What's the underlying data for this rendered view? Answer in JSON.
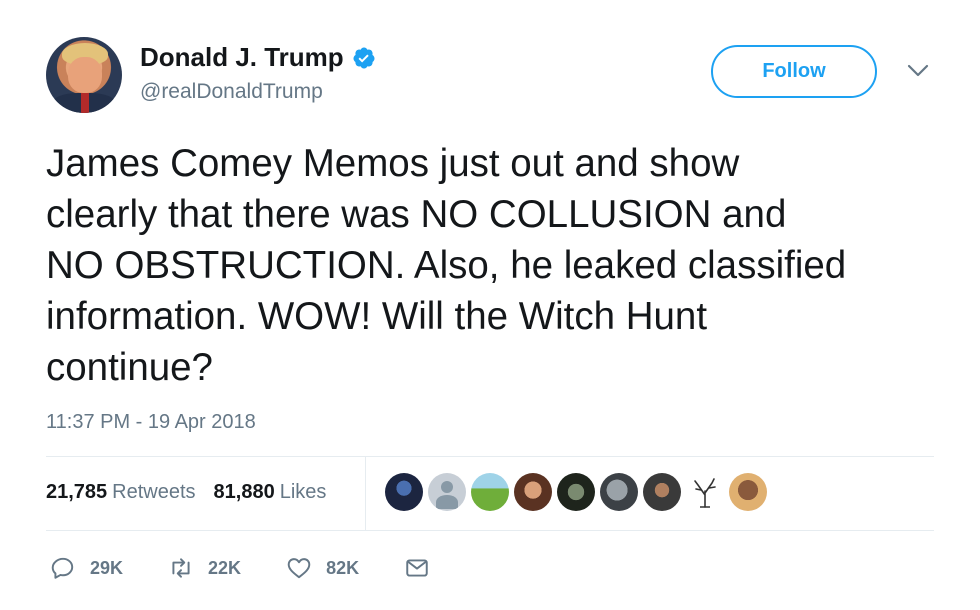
{
  "author": {
    "display_name": "Donald J. Trump",
    "handle": "@realDonaldTrump",
    "verified": true,
    "verified_color": "#1da1f2"
  },
  "follow_button": {
    "label": "Follow"
  },
  "tweet": {
    "text": "James Comey Memos just out and show\nclearly that there was NO COLLUSION and\nNO OBSTRUCTION. Also, he leaked classified\ninformation. WOW! Will the Witch Hunt\ncontinue?",
    "timestamp": "11:37 PM - 19 Apr 2018"
  },
  "stats": {
    "retweets_count": "21,785",
    "retweets_label": "Retweets",
    "likes_count": "81,880",
    "likes_label": "Likes"
  },
  "liker_avatars": [
    "avatar-1",
    "avatar-2",
    "avatar-3",
    "avatar-4",
    "avatar-5",
    "avatar-6",
    "avatar-7",
    "avatar-8",
    "avatar-9"
  ],
  "actions": {
    "replies": "29K",
    "retweets": "22K",
    "likes": "82K"
  },
  "colors": {
    "accent": "#1da1f2",
    "secondary_text": "#657786",
    "primary_text": "#14171a"
  }
}
